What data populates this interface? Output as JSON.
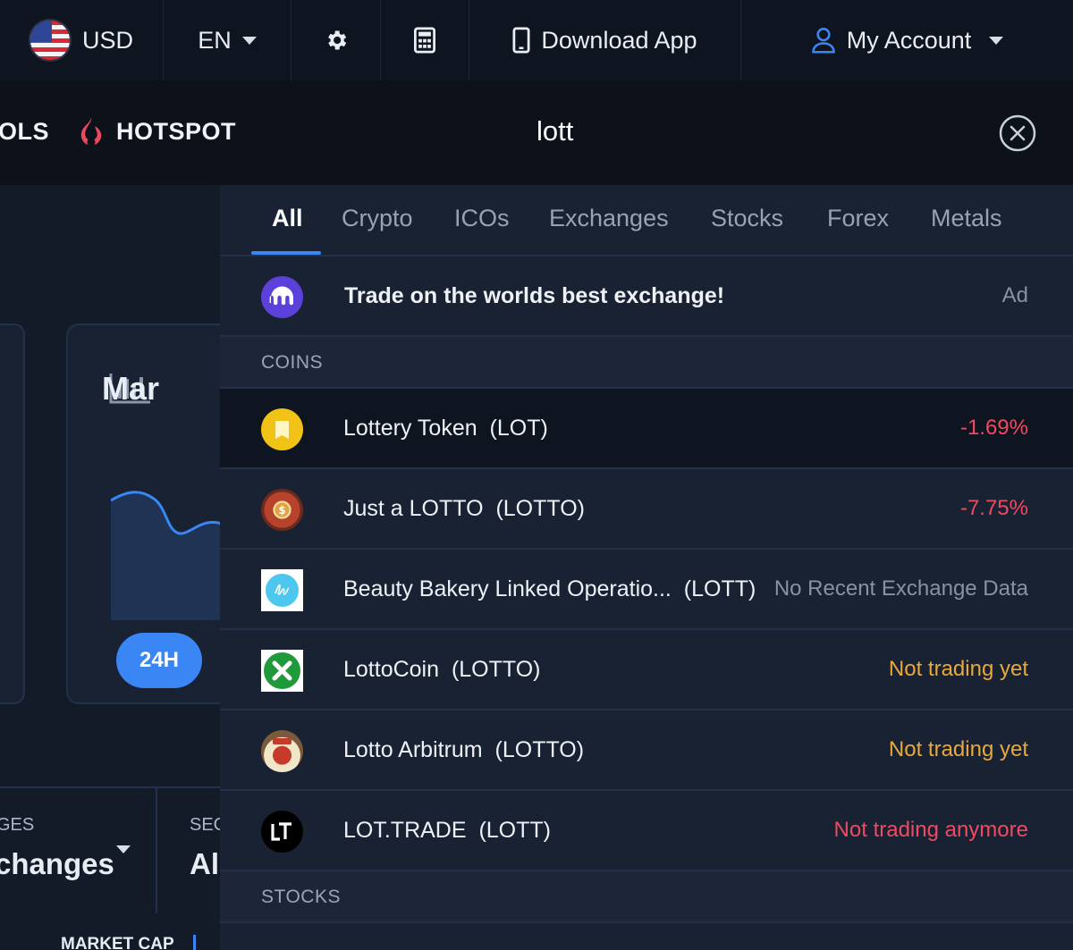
{
  "topbar": {
    "currency": "USD",
    "language": "EN",
    "download_label": "Download App",
    "account_label": "My Account"
  },
  "nav": {
    "tools_partial": "OLS",
    "hotspot_label": "HOTSPOT"
  },
  "search": {
    "value": "lott"
  },
  "background": {
    "card_title_partial": "Mar",
    "time_button": "24H",
    "filter1_label_partial": "GES",
    "filter1_value_partial": "changes",
    "filter2_label_partial": "SEC",
    "filter2_value_partial": "All",
    "market_cap_partial": "MARKET CAP"
  },
  "dropdown": {
    "tabs": [
      "All",
      "Crypto",
      "ICOs",
      "Exchanges",
      "Stocks",
      "Forex",
      "Metals"
    ],
    "active_tab": "All",
    "ad": {
      "text": "Trade on the worlds best exchange!",
      "tag": "Ad"
    },
    "sections": {
      "coins": "COINS",
      "stocks": "STOCKS"
    },
    "coins": [
      {
        "name": "Lottery Token",
        "symbol": "(LOT)",
        "status": "-1.69%",
        "status_type": "negative"
      },
      {
        "name": "Just a LOTTO",
        "symbol": "(LOTTO)",
        "status": "-7.75%",
        "status_type": "negative"
      },
      {
        "name": "Beauty Bakery Linked Operatio...",
        "symbol": "(LOTT)",
        "status": "No Recent Exchange Data",
        "status_type": "muted"
      },
      {
        "name": "LottoCoin",
        "symbol": "(LOTTO)",
        "status": "Not trading yet",
        "status_type": "warning"
      },
      {
        "name": "Lotto Arbitrum",
        "symbol": "(LOTTO)",
        "status": "Not trading yet",
        "status_type": "warning"
      },
      {
        "name": "LOT.TRADE",
        "symbol": "(LOTT)",
        "status": "Not trading anymore",
        "status_type": "negative"
      }
    ],
    "colors": {
      "negative": "#ef4a61",
      "warning": "#e9a93a",
      "muted": "#8792a5",
      "accent": "#3a86f5"
    }
  }
}
